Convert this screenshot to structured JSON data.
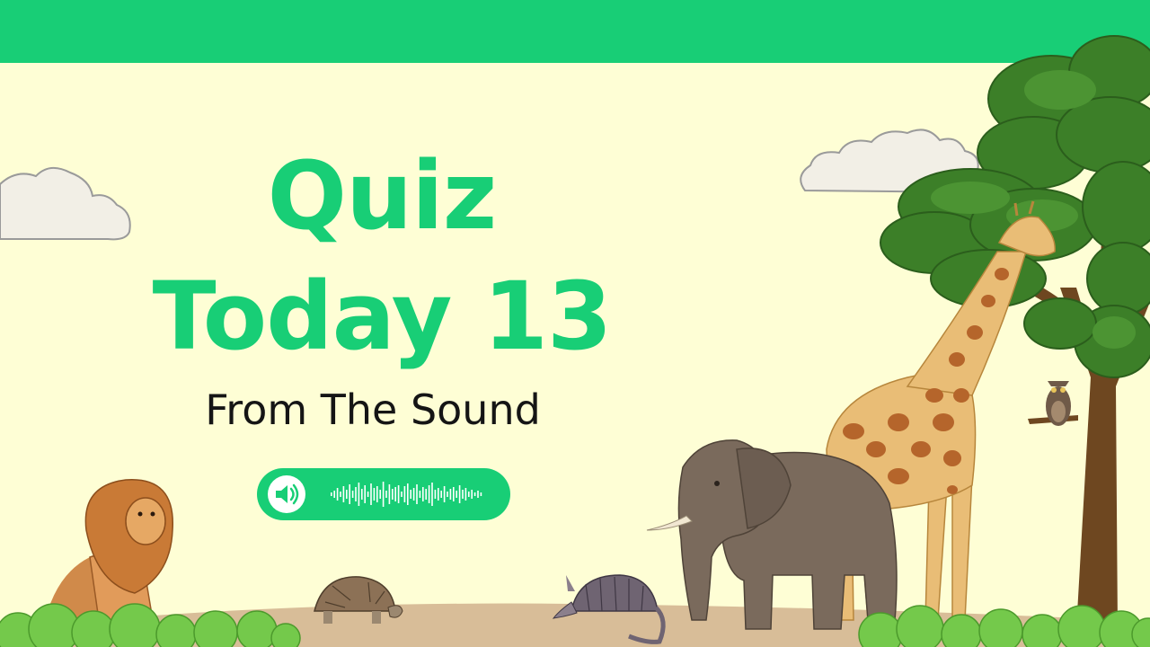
{
  "title": {
    "line1": "Quiz",
    "line2": "Today 13"
  },
  "subtitle": "From The Sound",
  "audio_player": {
    "icon": "speaker-icon"
  },
  "colors": {
    "brand_green": "#18ce76",
    "background": "#fefed5",
    "ground": "#d8bd98",
    "text_dark": "#151515"
  },
  "illustrations": [
    "cloud",
    "cloud",
    "tree",
    "giraffe",
    "elephant",
    "owl",
    "lion",
    "tortoise",
    "armadillo",
    "bushes"
  ]
}
